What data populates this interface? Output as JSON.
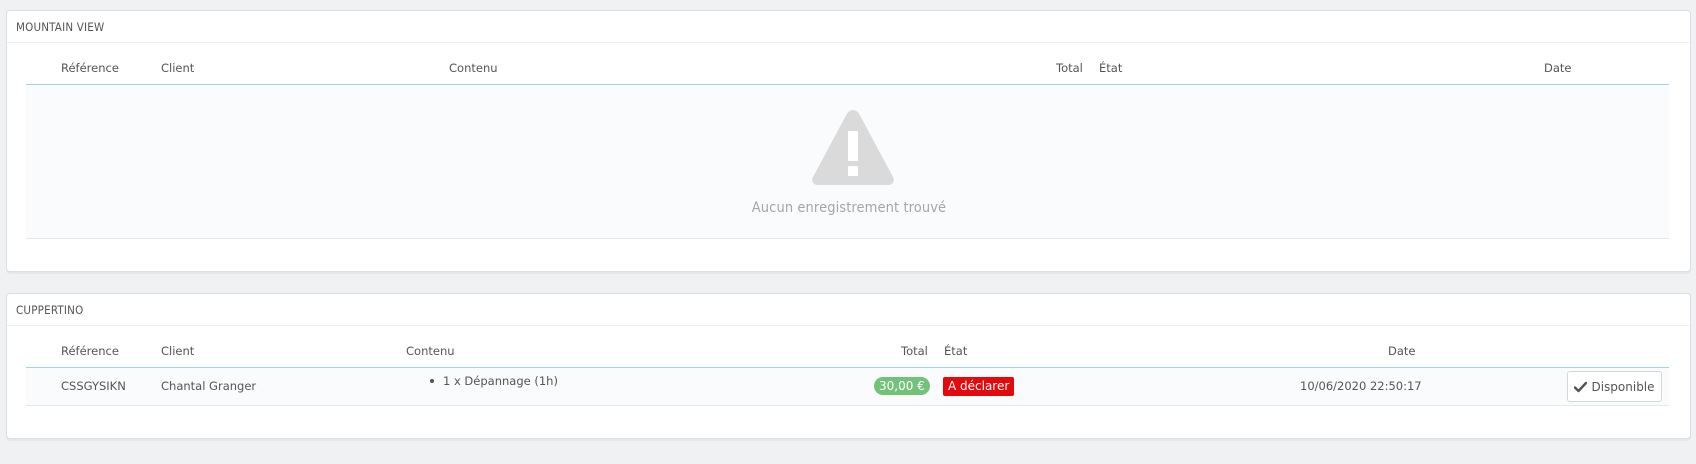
{
  "panels": [
    {
      "title": "MOUNTAIN VIEW",
      "columns": {
        "reference": "Référence",
        "client": "Client",
        "content": "Contenu",
        "total": "Total",
        "state": "État",
        "date": "Date"
      },
      "empty_message": "Aucun enregistrement trouvé",
      "empty_icon": "warning-icon"
    },
    {
      "title": "CUPPERTINO",
      "columns": {
        "reference": "Référence",
        "client": "Client",
        "content": "Contenu",
        "total": "Total",
        "state": "État",
        "date": "Date"
      },
      "rows": [
        {
          "reference": "CSSGYSIKN",
          "client": "Chantal Granger",
          "content_items": [
            "1 x Dépannage (1h)"
          ],
          "total": "30,00 €",
          "state": "A déclarer",
          "date": "10/06/2020 22:50:17",
          "action_label": "Disponible",
          "action_icon": "check-icon"
        }
      ]
    }
  ],
  "colors": {
    "background": "#eff1f2",
    "header_border": "#a5d2df",
    "total_badge": "#72c279",
    "state_badge": "#e3090c",
    "empty_text": "#a4a7a8",
    "warning_icon": "#dadada"
  }
}
